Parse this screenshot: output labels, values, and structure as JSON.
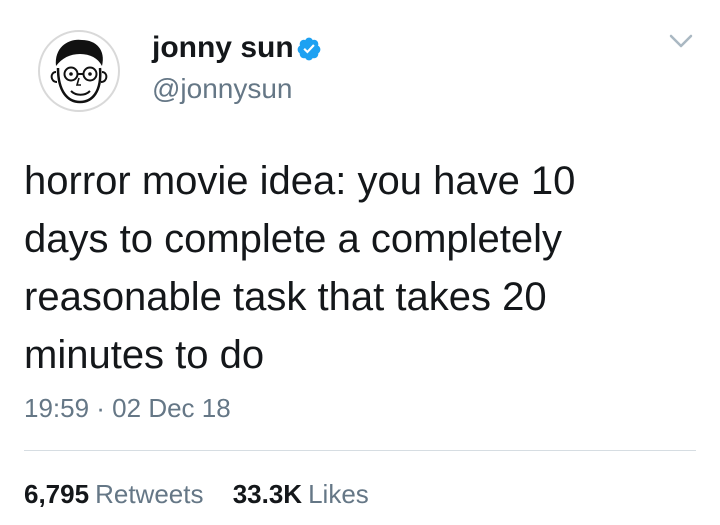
{
  "author": {
    "display_name": "jonny sun",
    "handle": "@jonnysun",
    "verified": true,
    "avatar_icon": "cartoon-face-avatar"
  },
  "tweet": {
    "text_lines": [
      "horror movie idea: you have 10",
      "days to complete a completely",
      "reasonable task that takes 20",
      "minutes to do"
    ],
    "timestamp": "19:59 · 02 Dec 18"
  },
  "stats": {
    "retweets_count": "6,795",
    "retweets_label": "Retweets",
    "likes_count": "33.3K",
    "likes_label": "Likes"
  },
  "colors": {
    "text_primary": "#14171a",
    "text_secondary": "#657786",
    "verified_blue": "#1da1f2",
    "divider": "#d6dde2",
    "caret": "#aab8c2"
  }
}
